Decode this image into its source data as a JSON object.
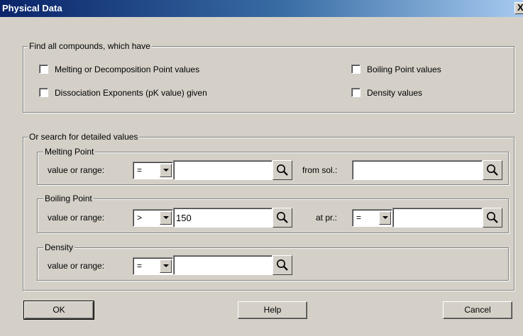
{
  "window": {
    "title": "Physical Data",
    "close_glyph": "X"
  },
  "find_all": {
    "legend": "Find all compounds, which have",
    "checkboxes": [
      {
        "label": "Melting or Decomposition Point values",
        "checked": false
      },
      {
        "label": "Boiling Point values",
        "checked": false
      },
      {
        "label": "Dissociation Exponents (pK value) given",
        "checked": false
      },
      {
        "label": "Density values",
        "checked": false
      }
    ]
  },
  "detailed": {
    "legend": "Or search for detailed values",
    "melting": {
      "legend": "Melting Point",
      "value_label": "value or range:",
      "operator": "=",
      "value": "",
      "sol_label": "from sol.:",
      "sol_value": ""
    },
    "boiling": {
      "legend": "Boiling Point",
      "value_label": "value or range:",
      "operator": ">",
      "value": "150",
      "pr_label": "at pr.:",
      "pr_operator": "=",
      "pr_value": ""
    },
    "density": {
      "legend": "Density",
      "value_label": "value or range:",
      "operator": "=",
      "value": ""
    }
  },
  "buttons": {
    "ok": "OK",
    "help": "Help",
    "cancel": "Cancel"
  },
  "icons": {
    "lookup": "magnifier-icon",
    "dropdown": "chevron-down-icon",
    "close": "close-icon"
  },
  "colors": {
    "face": "#d4d0c8",
    "title_start": "#0a246a",
    "title_end": "#a6caf0"
  }
}
